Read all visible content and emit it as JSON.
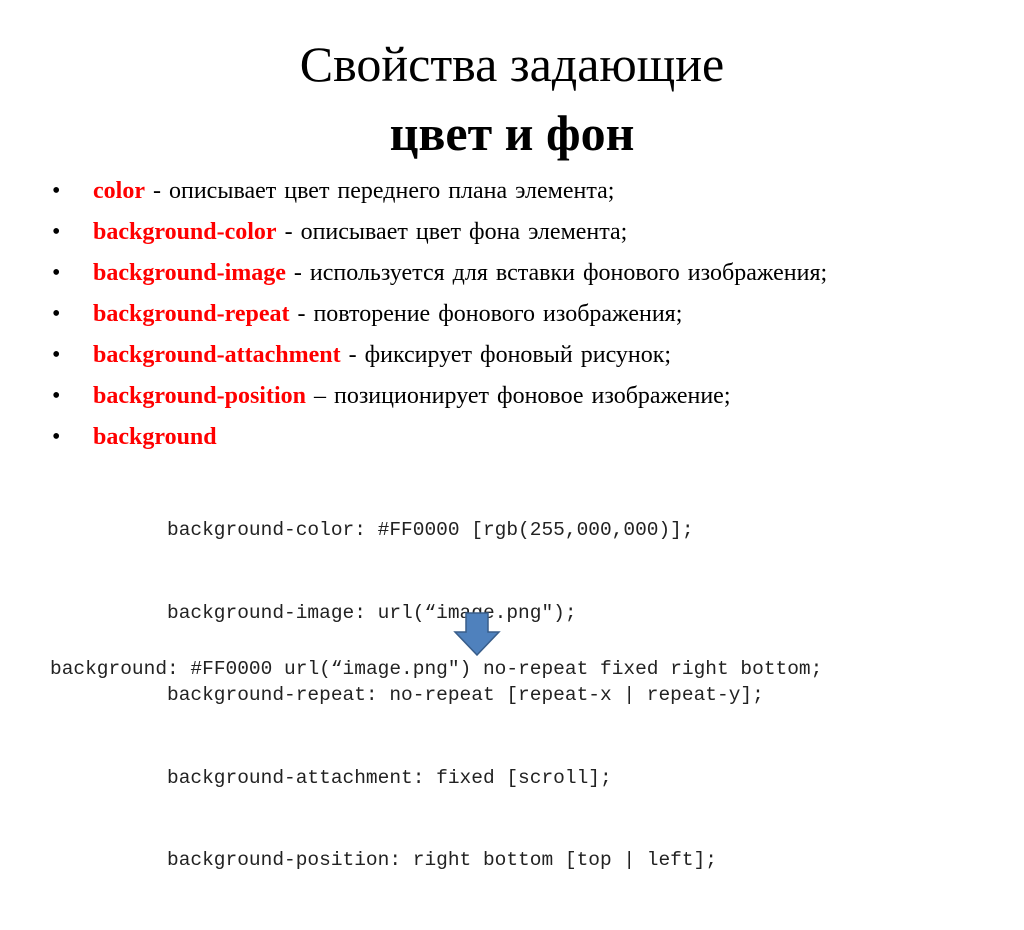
{
  "title": {
    "line1": "Свойства задающие",
    "line2": "цвет и фон"
  },
  "bullets": [
    {
      "property": "color",
      "description": " - описывает цвет переднего плана элемента;"
    },
    {
      "property": "background-color",
      "description": "  - описывает цвет фона элемента;"
    },
    {
      "property": "background-image",
      "description": "  - используется для вставки фонового изображения;"
    },
    {
      "property": "background-repeat",
      "description": "  - повторение фонового изображения;"
    },
    {
      "property": "background-attachment",
      "description": "  - фиксирует фоновый рисунок;"
    },
    {
      "property": "background-position",
      "description": " – позиционирует фоновое изображение;"
    },
    {
      "property": "background",
      "description": ""
    }
  ],
  "bullet_symbol": "•",
  "code_lines": [
    "background-color: #FF0000 [rgb(255,000,000)];",
    "background-image: url(“image.png\");",
    "background-repeat: no-repeat [repeat-x | repeat-y];",
    "background-attachment: fixed [scroll];",
    "background-position: right bottom [top | left];"
  ],
  "shorthand": "background: #FF0000 url(“image.png\") no-repeat fixed right bottom;",
  "colors": {
    "property_red": "#FF0000",
    "arrow_fill": "#4F81BD",
    "arrow_stroke": "#385D8A"
  }
}
